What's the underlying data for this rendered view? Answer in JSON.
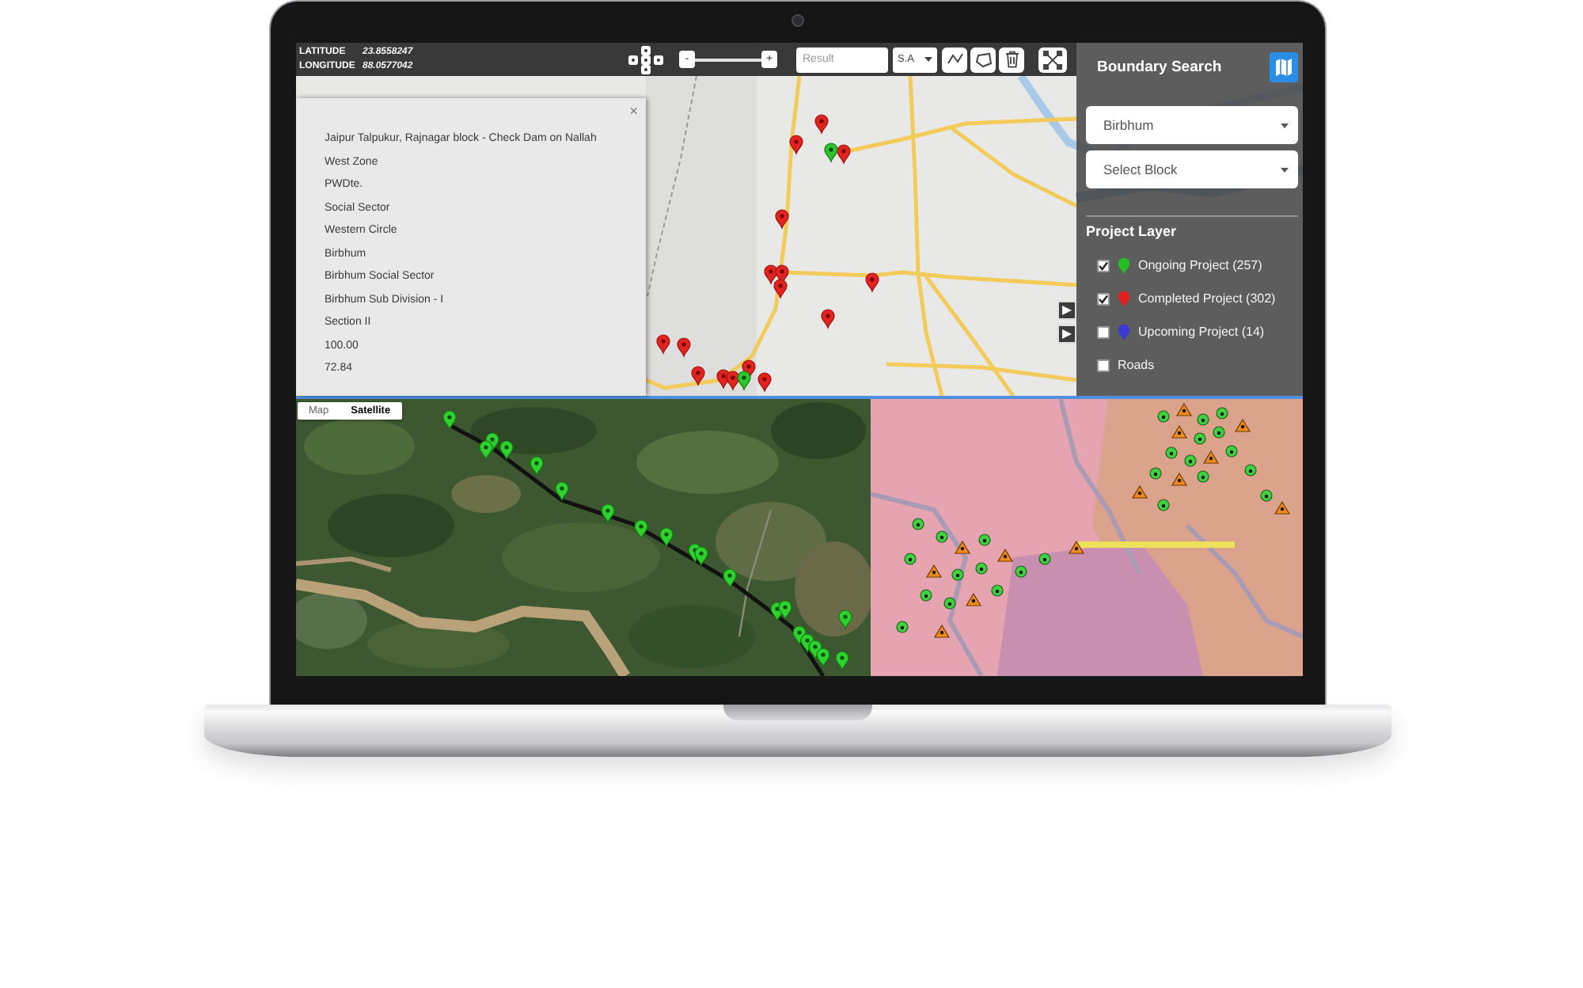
{
  "toolbar": {
    "coordinates": [
      {
        "label": "LATITUDE",
        "value": "23.8558247"
      },
      {
        "label": "LONGITUDE",
        "value": "88.0577042"
      }
    ],
    "zoom": {
      "minus": "-",
      "plus": "+"
    },
    "result_field": {
      "placeholder": "Result"
    },
    "unit_select": {
      "value": "S.A"
    }
  },
  "popup": {
    "close": "×",
    "lines": [
      "Jaipur Talpukur, Rajnagar block - Check Dam on Nallah",
      "West Zone",
      "PWDte.",
      "Social Sector",
      "Western Circle",
      "Birbhum",
      "Birbhum Social Sector",
      "Birbhum Sub Division - I",
      "Section II",
      "100.00",
      "72.84"
    ]
  },
  "boundary_panel": {
    "title": "Boundary Search",
    "district_select": {
      "value": "Birbhum"
    },
    "block_select": {
      "value": "Select Block"
    },
    "layer_title": "Project Layer",
    "layers": [
      {
        "label": "Ongoing Project (257)",
        "checked": true,
        "kind": "pin",
        "color": "#22c022"
      },
      {
        "label": "Completed Project (302)",
        "checked": true,
        "kind": "pin",
        "color": "#e02020"
      },
      {
        "label": "Upcoming Project (14)",
        "checked": false,
        "kind": "pin",
        "color": "#3a3ad8"
      },
      {
        "label": "Roads",
        "checked": false,
        "kind": "plain"
      }
    ]
  },
  "satellite_map": {
    "map_types": [
      {
        "label": "Map",
        "selected": false
      },
      {
        "label": "Satellite",
        "selected": true
      }
    ]
  }
}
